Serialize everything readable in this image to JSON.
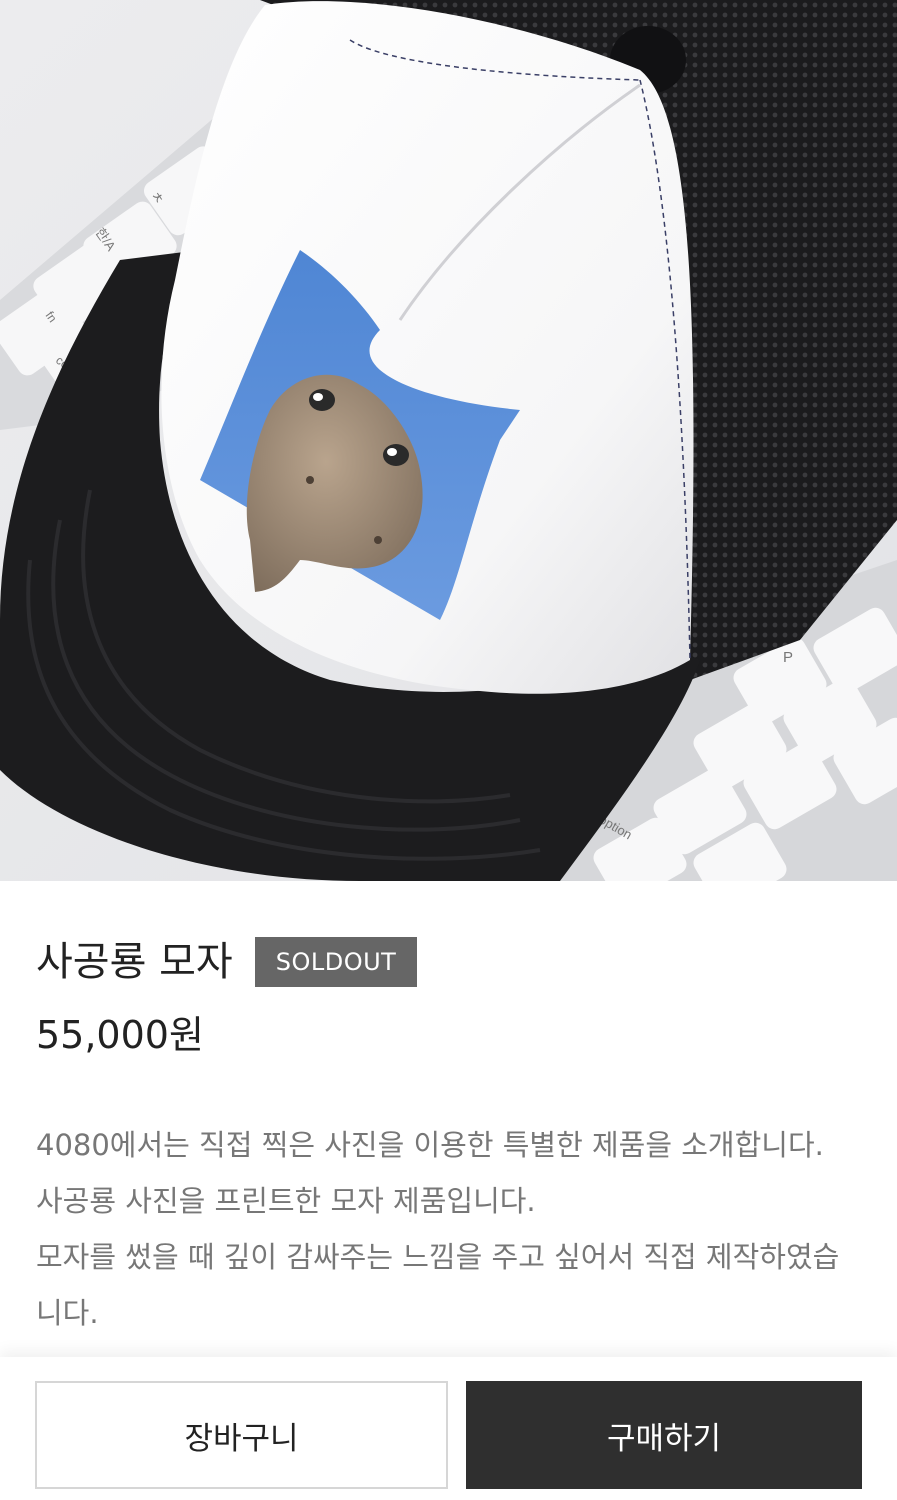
{
  "product": {
    "image_alt": "",
    "name": "사공룡 모자",
    "status_badge": "SOLDOUT",
    "price": "55,000원",
    "description": [
      "4080에서는 직접 찍은 사진을 이용한 특별한 제품을 소개합니다.",
      "사공룡 사진을 프린트한 모자 제품입니다.",
      "모자를 썼을 때 깊이 감싸주는 느낌을 주고 싶어서 직접 제작하였습니다."
    ]
  },
  "keyboard_keys": {
    "k1": "ㅊ",
    "k2": "한/A",
    "k3": "fn",
    "k4": "control",
    "k5": "P",
    "k6": "option"
  },
  "actions": {
    "cart_label": "장바구니",
    "buy_label": "구매하기"
  },
  "colors": {
    "badge_bg": "#666666",
    "buy_button_bg": "#2f2f2f",
    "sky_blue": "#5b8fd6"
  }
}
